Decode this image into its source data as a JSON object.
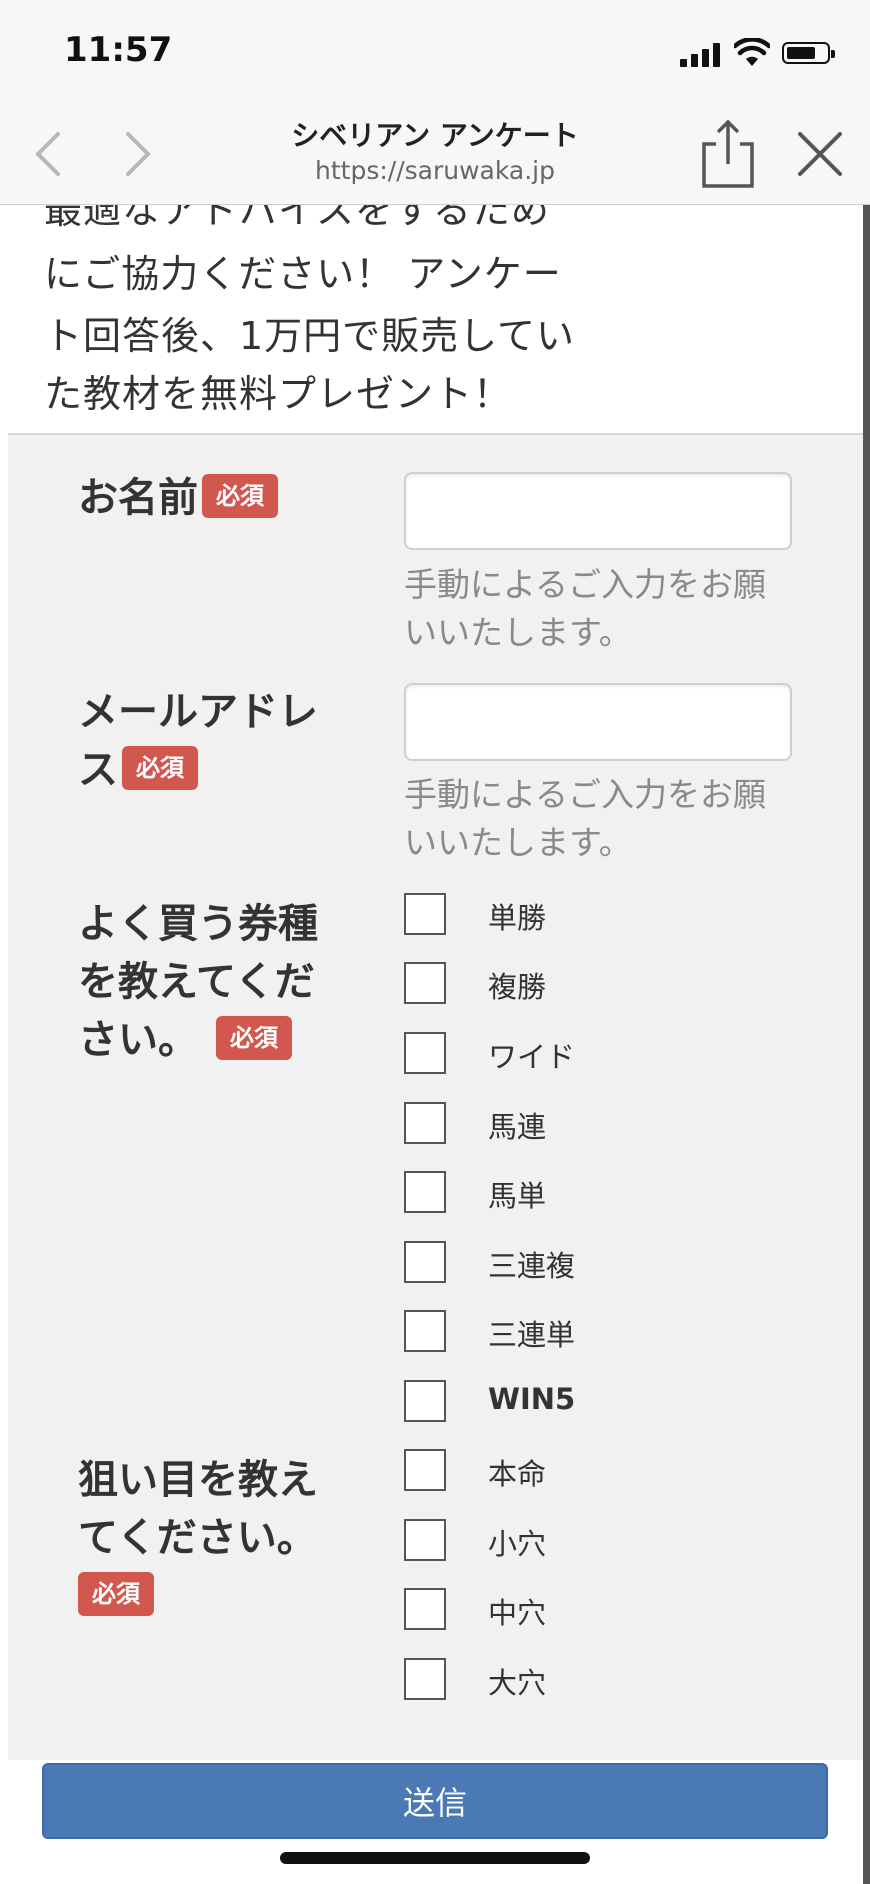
{
  "status_bar": {
    "time": "11:57"
  },
  "browser": {
    "title": "シベリアン アンケート",
    "url": "https://saruwaka.jp"
  },
  "intro": {
    "lines": [
      "最適なアドバイスをするため",
      "にご協力ください！ アンケー",
      "ト回答後、1万円で販売してい",
      "た教材を無料プレゼント！"
    ]
  },
  "form": {
    "required_badge": "必須",
    "name": {
      "label": "お名前",
      "value": "",
      "hint_line1": "手動によるご入力をお願",
      "hint_line2": "いいたします。"
    },
    "email": {
      "label_line1": "メールアドレ",
      "label_line2": "ス",
      "value": "",
      "hint_line1": "手動によるご入力をお願",
      "hint_line2": "いいたします。"
    },
    "ticket_types": {
      "label_line1": "よく買う券種",
      "label_line2": "を教えてくだ",
      "label_line3": "さい。",
      "options": [
        "単勝",
        "複勝",
        "ワイド",
        "馬連",
        "馬単",
        "三連複",
        "三連単",
        "WIN5"
      ]
    },
    "target": {
      "label_line1": "狙い目を教え",
      "label_line2": "てください。",
      "options": [
        "本命",
        "小穴",
        "中穴",
        "大穴"
      ]
    },
    "submit_label": "送信"
  }
}
